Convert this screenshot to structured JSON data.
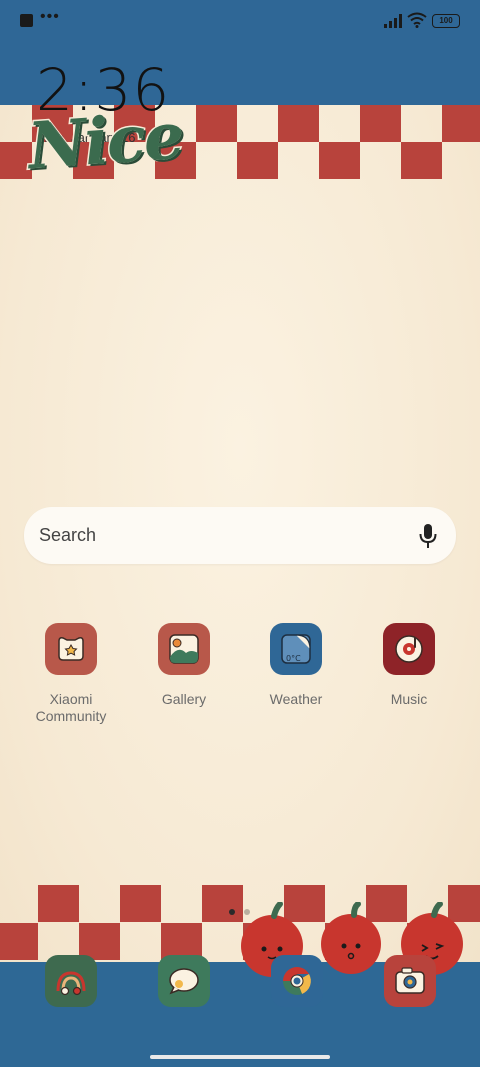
{
  "status_bar": {
    "battery": "100"
  },
  "clock": {
    "time": "2:36",
    "date": "Tue, January 16"
  },
  "widget": {
    "decor_text": "Nice"
  },
  "search": {
    "placeholder": "Search"
  },
  "apps": [
    {
      "label": "Xiaomi Community",
      "icon": "community-icon",
      "color": "#b8584a"
    },
    {
      "label": "Gallery",
      "icon": "gallery-icon",
      "color": "#b8584a"
    },
    {
      "label": "Weather",
      "icon": "weather-icon",
      "color": "#2f6796"
    },
    {
      "label": "Music",
      "icon": "music-icon",
      "color": "#8e2328"
    }
  ],
  "dock": [
    {
      "icon": "phone-icon",
      "color": "#3e6a4f"
    },
    {
      "icon": "messages-icon",
      "color": "#3e7a5c"
    },
    {
      "icon": "chrome-icon",
      "color": "#2f6796"
    },
    {
      "icon": "camera-icon",
      "color": "#b8433c"
    }
  ],
  "colors": {
    "checker_red": "#b8433c",
    "cream": "#f7ecd8",
    "blue": "#2f6796"
  }
}
